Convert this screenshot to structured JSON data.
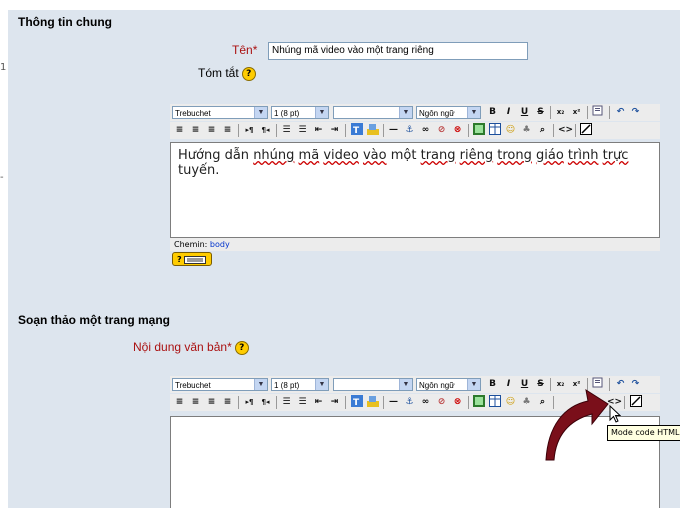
{
  "sections": {
    "general": {
      "title": "Thông tin chung",
      "name_label": "Tên",
      "required_mark": "*",
      "name_value": "Nhúng mã video vào một trang riêng",
      "summary_label": "Tóm tắt",
      "editor_text_parts": [
        "Hướng dẫn ",
        "nhúng",
        " ",
        "mã",
        " ",
        "video",
        " ",
        "vào",
        " một ",
        "trang",
        " ",
        "riêng",
        " ",
        "trong",
        " ",
        "giáo",
        " ",
        "trình",
        " ",
        "trực",
        " tuyến."
      ],
      "path_label": "Chemin:",
      "path_value": "body",
      "help_button_label": "?"
    },
    "compose": {
      "title": "Soạn thảo một trang mạng",
      "content_label": "Nội dung văn bản",
      "required_mark": "*"
    }
  },
  "toolbar": {
    "font_family": "Trebuchet",
    "font_size": "1 (8 pt)",
    "style_value": "",
    "language": "Ngôn ngữ",
    "bold": "B",
    "italic": "I",
    "underline": "U",
    "strike": "S",
    "subscript": "x₂",
    "superscript": "x²"
  },
  "tooltip": "Mode code HTML",
  "stray_chars": {
    "a": "1",
    "b": "-"
  },
  "colors": {
    "panel": "#dde5ee",
    "required": "#aa1111",
    "arrow": "#7a0f1a",
    "help": "#ffcc00"
  }
}
